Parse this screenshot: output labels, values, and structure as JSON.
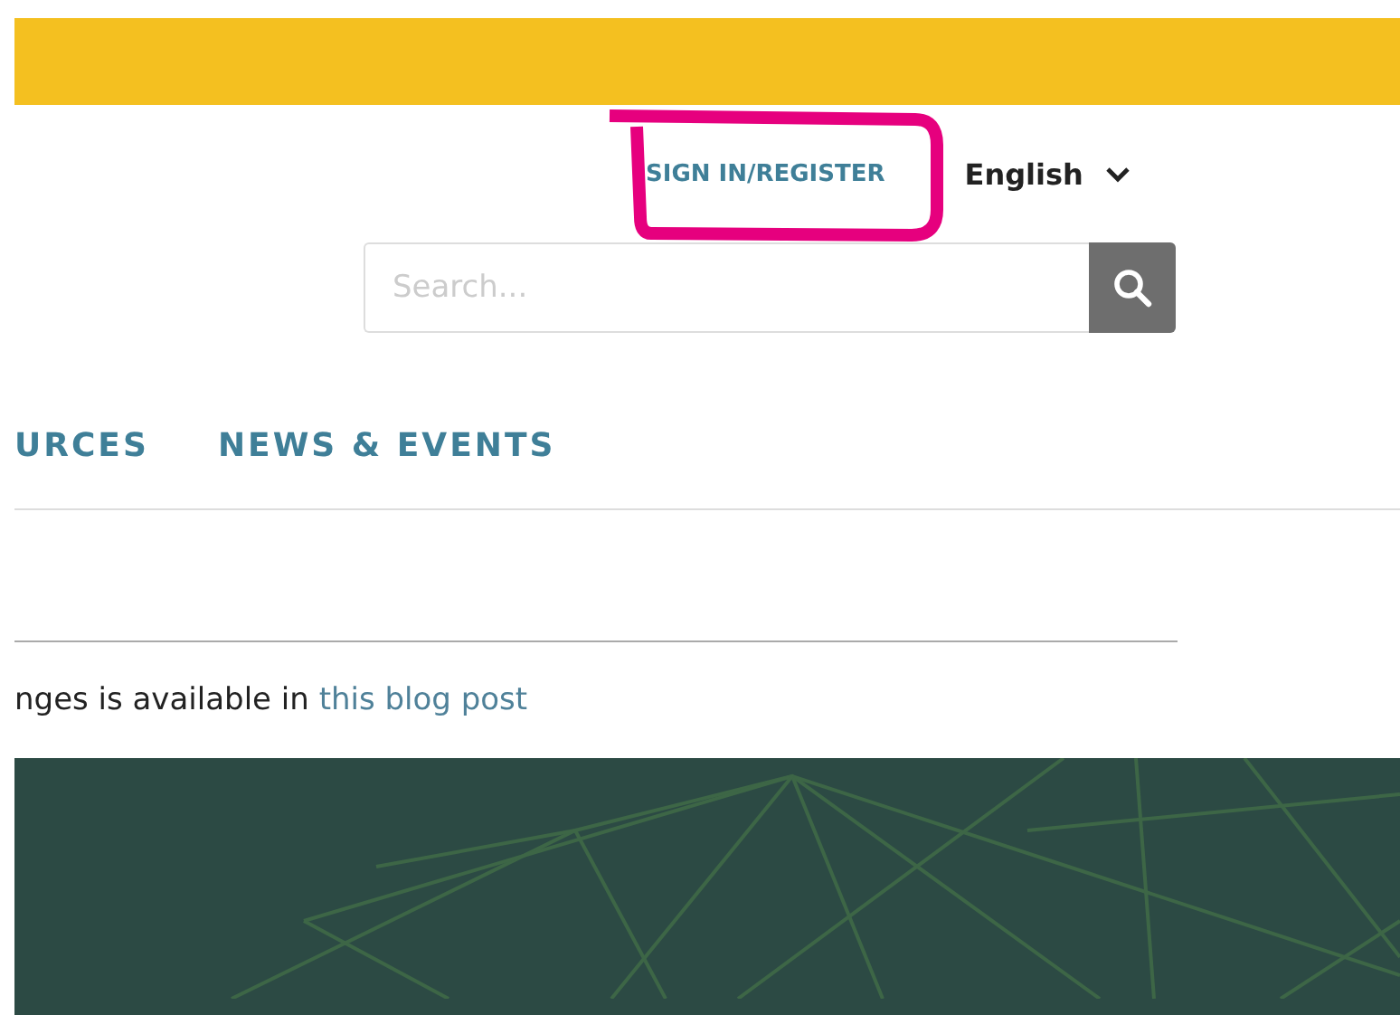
{
  "header": {
    "sign_in": "SIGN IN/REGISTER",
    "language": "English",
    "highlighted": true
  },
  "search": {
    "placeholder": "Search..."
  },
  "nav": {
    "items": [
      {
        "label": "URCES"
      },
      {
        "label": "NEWS & EVENTS"
      }
    ]
  },
  "notice": {
    "text": "nges is available in ",
    "link": "this blog post"
  }
}
